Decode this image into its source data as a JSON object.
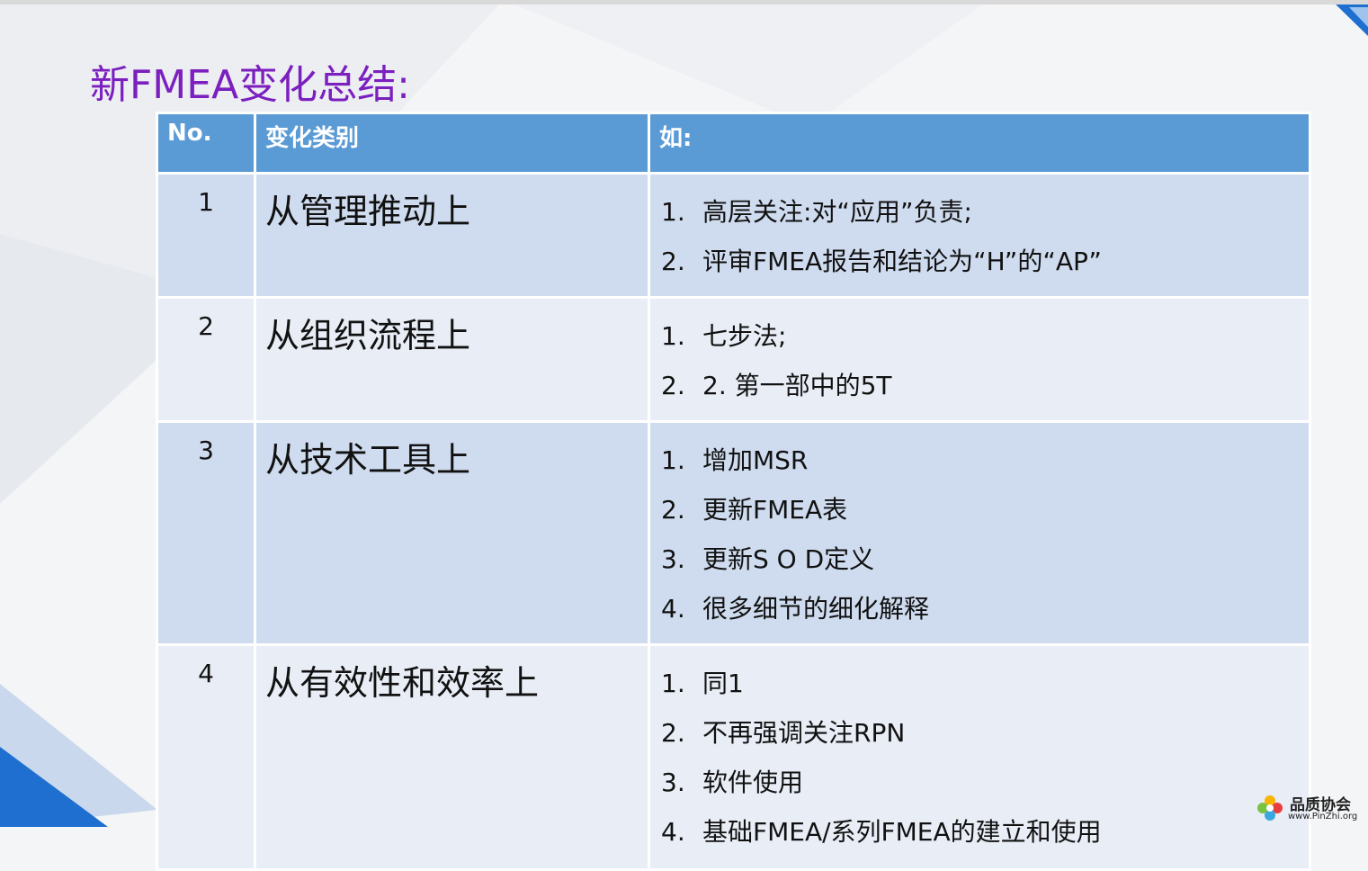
{
  "slide": {
    "title": "新FMEA变化总结:"
  },
  "table": {
    "headers": [
      "No.",
      "变化类别",
      "如:"
    ],
    "rows": [
      {
        "no": "1",
        "category": "从管理推动上",
        "items": [
          {
            "num": "1.",
            "text": "高层关注:对“应用”负责;"
          },
          {
            "num": "2.",
            "text": "评审FMEA报告和结论为“H”的“AP”"
          }
        ]
      },
      {
        "no": "2",
        "category": "从组织流程上",
        "items": [
          {
            "num": "1.",
            "text": "七步法;"
          },
          {
            "num": "2.",
            "text": "2. 第一部中的5T"
          }
        ]
      },
      {
        "no": "3",
        "category": "从技术工具上",
        "items": [
          {
            "num": "1.",
            "text": "增加MSR"
          },
          {
            "num": "2.",
            "text": "更新FMEA表"
          },
          {
            "num": "3.",
            "text": "更新S O D定义"
          },
          {
            "num": "4.",
            "text": "很多细节的细化解释"
          }
        ]
      },
      {
        "no": "4",
        "category": "从有效性和效率上",
        "items": [
          {
            "num": "1.",
            "text": "同1"
          },
          {
            "num": "2.",
            "text": "不再强调关注RPN"
          },
          {
            "num": "3.",
            "text": "软件使用"
          },
          {
            "num": "4.",
            "text": "基础FMEA/系列FMEA的建立和使用"
          }
        ]
      }
    ]
  },
  "watermark": {
    "name": "品质协会",
    "url": "www.PinZhi.org",
    "icon": "flower-logo-icon"
  },
  "colors": {
    "title": "#7b1fbf",
    "header_bg": "#5b9bd5",
    "row_odd": "#cfdcef",
    "row_even": "#e8edf6"
  }
}
